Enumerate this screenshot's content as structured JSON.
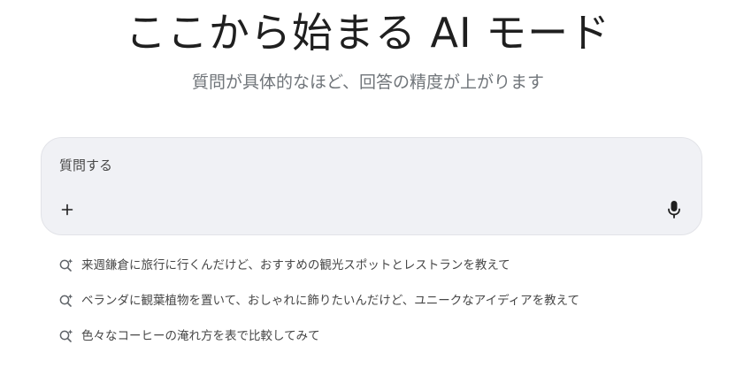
{
  "hero": {
    "title": "ここから始まる AI モード",
    "subtitle": "質問が具体的なほど、回答の精度が上がります"
  },
  "search": {
    "placeholder": "質問する",
    "value": "",
    "icons": {
      "add": "plus-icon",
      "voice": "mic-icon"
    }
  },
  "suggestions": {
    "icon": "search-spark-icon",
    "items": [
      "来週鎌倉に旅行に行くんだけど、おすすめの観光スポットとレストランを教えて",
      "ベランダに観葉植物を置いて、おしゃれに飾りたいんだけど、ユニークなアイディアを教えて",
      "色々なコーヒーの淹れ方を表で比較してみて"
    ]
  },
  "colors": {
    "background": "#ffffff",
    "search_box": "#f0f1f5",
    "title": "#1f1f1f",
    "subtitle": "#70757a",
    "suggestion_text": "#474747"
  }
}
